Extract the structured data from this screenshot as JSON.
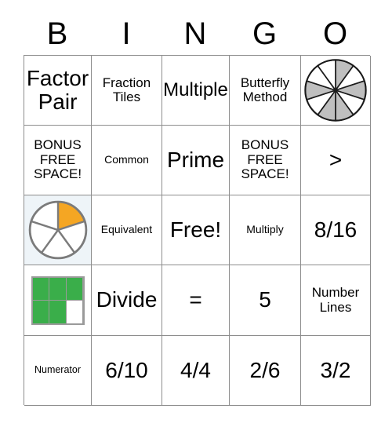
{
  "header": {
    "letters": [
      "B",
      "I",
      "N",
      "G",
      "O"
    ]
  },
  "grid": {
    "rows": 5,
    "columns": 5,
    "cells": [
      [
        {
          "type": "text",
          "text": "Factor Pair",
          "size": "xl",
          "highlight": false
        },
        {
          "type": "text",
          "text": "Fraction Tiles",
          "size": "md",
          "highlight": false
        },
        {
          "type": "text",
          "text": "Multiple",
          "size": "lg",
          "highlight": false
        },
        {
          "type": "text",
          "text": "Butterfly Method",
          "size": "md",
          "highlight": false
        },
        {
          "type": "pie-10",
          "text": "",
          "highlight": false
        }
      ],
      [
        {
          "type": "text",
          "text": "BONUS FREE SPACE!",
          "size": "md",
          "highlight": false
        },
        {
          "type": "text",
          "text": "Common",
          "size": "sm",
          "highlight": false
        },
        {
          "type": "text",
          "text": "Prime",
          "size": "xl",
          "highlight": false
        },
        {
          "type": "text",
          "text": "BONUS FREE SPACE!",
          "size": "md",
          "highlight": false
        },
        {
          "type": "text",
          "text": ">",
          "size": "xl",
          "highlight": false
        }
      ],
      [
        {
          "type": "pie-5",
          "text": "",
          "highlight": true
        },
        {
          "type": "text",
          "text": "Equivalent",
          "size": "sm",
          "highlight": false
        },
        {
          "type": "text",
          "text": "Free!",
          "size": "xl",
          "highlight": false
        },
        {
          "type": "text",
          "text": "Multiply",
          "size": "sm",
          "highlight": false
        },
        {
          "type": "text",
          "text": "8/16",
          "size": "xl",
          "highlight": false
        }
      ],
      [
        {
          "type": "squares",
          "text": "",
          "highlight": false
        },
        {
          "type": "text",
          "text": "Divide",
          "size": "xl",
          "highlight": false
        },
        {
          "type": "text",
          "text": "=",
          "size": "xl",
          "highlight": false
        },
        {
          "type": "text",
          "text": "5",
          "size": "xl",
          "highlight": false
        },
        {
          "type": "text",
          "text": "Number Lines",
          "size": "md",
          "highlight": false
        }
      ],
      [
        {
          "type": "text",
          "text": "Numerator",
          "size": "xs",
          "highlight": false
        },
        {
          "type": "text",
          "text": "6/10",
          "size": "xl",
          "highlight": false
        },
        {
          "type": "text",
          "text": "4/4",
          "size": "xl",
          "highlight": false
        },
        {
          "type": "text",
          "text": "2/6",
          "size": "xl",
          "highlight": false
        },
        {
          "type": "text",
          "text": "3/2",
          "size": "xl",
          "highlight": false
        }
      ]
    ]
  },
  "graphics": {
    "pie_10": {
      "name": "fraction-pie-tenths",
      "slices": 10,
      "shaded": 5,
      "shaded_indices": [
        0,
        2,
        4,
        5,
        7
      ],
      "fill_color": "#bfbfbf",
      "empty_color": "#ffffff",
      "stroke_color": "#1a1a1a"
    },
    "pie_5": {
      "name": "fraction-pie-fifths",
      "slices": 5,
      "shaded": 1,
      "shaded_indices": [
        0
      ],
      "fill_color": "#f5a623",
      "empty_color": "#ffffff",
      "stroke_color": "#7b7b7b"
    },
    "squares": {
      "name": "fraction-squares-five-sixths",
      "columns": 3,
      "rows": 2,
      "filled": 5,
      "total": 6,
      "filled_indices": [
        0,
        1,
        2,
        3,
        4
      ],
      "fill_color": "#3aae4a",
      "empty_color": "#ffffff",
      "border_color": "#9a9a9a"
    }
  },
  "colors": {
    "grid_line": "#8d8d8d",
    "highlight_cell": "#eef4f8",
    "text": "#000000",
    "page_background": "#ffffff"
  }
}
